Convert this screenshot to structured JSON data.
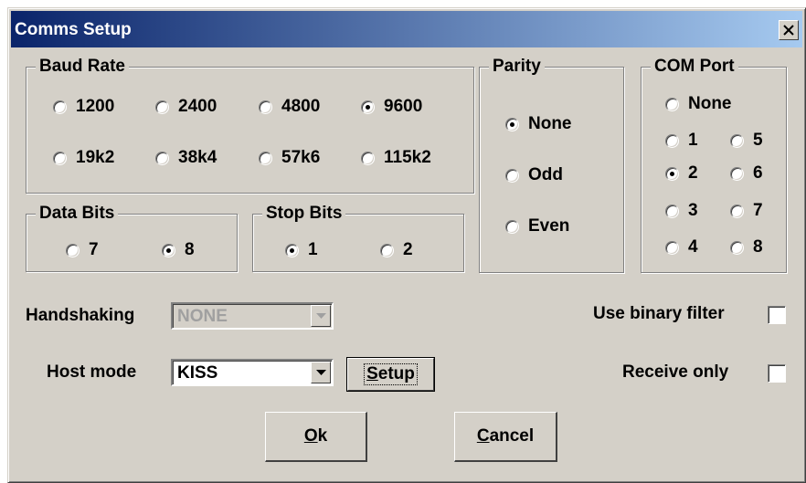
{
  "window": {
    "title": "Comms Setup"
  },
  "baud_rate": {
    "legend": "Baud Rate",
    "options": [
      "1200",
      "2400",
      "4800",
      "9600",
      "19k2",
      "38k4",
      "57k6",
      "115k2"
    ],
    "selected": "9600"
  },
  "parity": {
    "legend": "Parity",
    "options": [
      "None",
      "Odd",
      "Even"
    ],
    "selected": "None"
  },
  "com_port": {
    "legend": "COM Port",
    "options": [
      "None",
      "1",
      "5",
      "2",
      "6",
      "3",
      "7",
      "4",
      "8"
    ],
    "selected": "2"
  },
  "data_bits": {
    "legend": "Data Bits",
    "options": [
      "7",
      "8"
    ],
    "selected": "8"
  },
  "stop_bits": {
    "legend": "Stop Bits",
    "options": [
      "1",
      "2"
    ],
    "selected": "1"
  },
  "handshaking": {
    "label": "Handshaking",
    "value": "NONE",
    "disabled": true
  },
  "host_mode": {
    "label": "Host mode",
    "value": "KISS",
    "setup_button_pre": "S",
    "setup_button_rest": "etup"
  },
  "binary_filter": {
    "label": "Use binary filter",
    "checked": false
  },
  "receive_only": {
    "label": "Receive only",
    "checked": false
  },
  "buttons": {
    "ok_pre": "O",
    "ok_rest": "k",
    "cancel_pre": "C",
    "cancel_rest": "ancel"
  },
  "icons": {
    "close": "close-icon",
    "dropdown": "chevron-down-icon"
  }
}
